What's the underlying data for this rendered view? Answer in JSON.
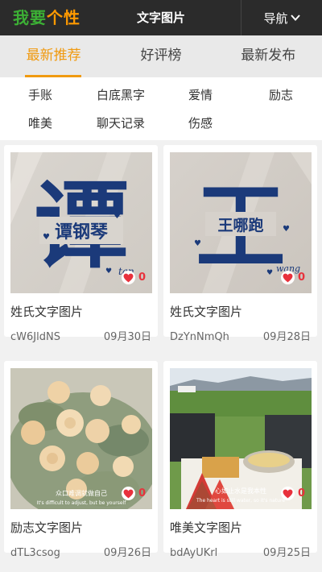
{
  "header": {
    "logo_part1": "我要",
    "logo_part2": "个性",
    "title": "文字图片",
    "nav_label": "导航"
  },
  "tabs": [
    {
      "label": "最新推荐",
      "active": true
    },
    {
      "label": "好评榜",
      "active": false
    },
    {
      "label": "最新发布",
      "active": false
    }
  ],
  "categories": [
    "手账",
    "白底黑字",
    "爱情",
    "励志",
    "唯美",
    "聊天记录",
    "伤感"
  ],
  "cards": [
    {
      "title": "姓氏文字图片",
      "author": "cW6JldNS",
      "date": "09月30日",
      "likes": "0",
      "image": {
        "big_char": "谭",
        "banner": "谭钢琴",
        "sign": "tan"
      }
    },
    {
      "title": "姓氏文字图片",
      "author": "DzYnNmQh",
      "date": "09月28日",
      "likes": "0",
      "image": {
        "big_char": "王",
        "banner": "王哪跑",
        "sign": "wang"
      }
    },
    {
      "title": "励志文字图片",
      "author": "dTL3csog",
      "date": "09月26日",
      "likes": "0",
      "image": {
        "caption_cn": "众口难调就做自己",
        "caption_en": "It's difficult to adjust, but be yourself"
      }
    },
    {
      "title": "唯美文字图片",
      "author": "bdAyUKrl",
      "date": "09月25日",
      "likes": "0",
      "image": {
        "caption_cn": "心如止水是我本性",
        "caption_en": "The heart is still water, so it's nature"
      }
    }
  ],
  "colors": {
    "header_bg": "#2b2b2b",
    "accent": "#f09a10",
    "logo_green": "#3cb035",
    "logo_orange": "#ff9a00",
    "like_red": "#e8313c",
    "ink_blue": "#1b3a7a"
  },
  "icons": {
    "nav": "chevron-down-icon",
    "like": "heart-icon"
  }
}
